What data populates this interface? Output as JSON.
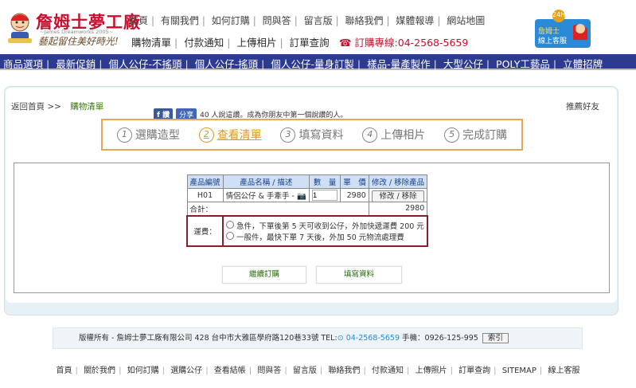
{
  "brand": {
    "title": "詹姆士夢工廠",
    "sub": "~James Dreamworks 2005~",
    "slogan": "藝起留住美好時光!"
  },
  "top_links": [
    "首頁",
    "有關我們",
    "如何訂購",
    "問與答",
    "留言版",
    "聯絡我們",
    "媒體報導",
    "網站地圖"
  ],
  "sub_links": [
    "購物清單",
    "付款通知",
    "上傳相片",
    "訂單查詢"
  ],
  "hotline": "☎ 訂購專線:04-2568-5659",
  "cs": {
    "badge": "24H",
    "label1": "詹姆士",
    "label2": "線上客服"
  },
  "nav": [
    "商品選項",
    "最新促銷",
    "個人公仔-不搖頭",
    "個人公仔-搖頭",
    "個人公仔-量身訂製",
    "樣品-量產製作",
    "大型公仔",
    "POLY工藝品",
    "立體招牌"
  ],
  "breadcrumb": {
    "home": "返回首頁 >>",
    "current": "購物清單"
  },
  "share": {
    "like": "讚",
    "share": "分享",
    "text": "40 人說這讚。成為你朋友中第一個說讚的人。"
  },
  "recommend": "推薦好友",
  "steps": [
    {
      "num": "1",
      "label": "選購造型",
      "active": false
    },
    {
      "num": "2",
      "label": "查看清單",
      "active": true
    },
    {
      "num": "3",
      "label": "填寫資料",
      "active": false
    },
    {
      "num": "4",
      "label": "上傳相片",
      "active": false
    },
    {
      "num": "5",
      "label": "完成訂購",
      "active": false
    }
  ],
  "cart": {
    "headers": [
      "產品編號",
      "產品名稱 / 描述",
      "數　量",
      "單　價",
      "修改 / 移除產品"
    ],
    "row": {
      "id": "H01",
      "name": "情侶公仔 & 手牽手 -",
      "qty": "1",
      "price": "2980",
      "action": "修改 / 移除"
    },
    "total_label": "合計：",
    "total": "2980",
    "fee_label": "運費：",
    "fee_options": [
      "急件，下單後第 5 天可收到公仔，外加快遞運費 200 元",
      "一般件，最快下單 7 天後，外加 50 元物流處理費"
    ]
  },
  "buttons": {
    "continue": "繼續訂購",
    "fill": "填寫資料"
  },
  "footer": {
    "text": "版權所有 - 詹姆士夢工廠有限公司 428 台中市大雅區學府路120巷33號 TEL:",
    "tel": "04-2568-5659",
    "mobile": "手機：0926-125-995",
    "index": "索引"
  },
  "bottom_links": [
    "首頁",
    "關於我們",
    "如何訂購",
    "選購公仔",
    "查看結帳",
    "問與答",
    "留言版",
    "聯絡我們",
    "付款通知",
    "上傳照片",
    "訂單查詢",
    "SITEMAP",
    "線上客服"
  ]
}
